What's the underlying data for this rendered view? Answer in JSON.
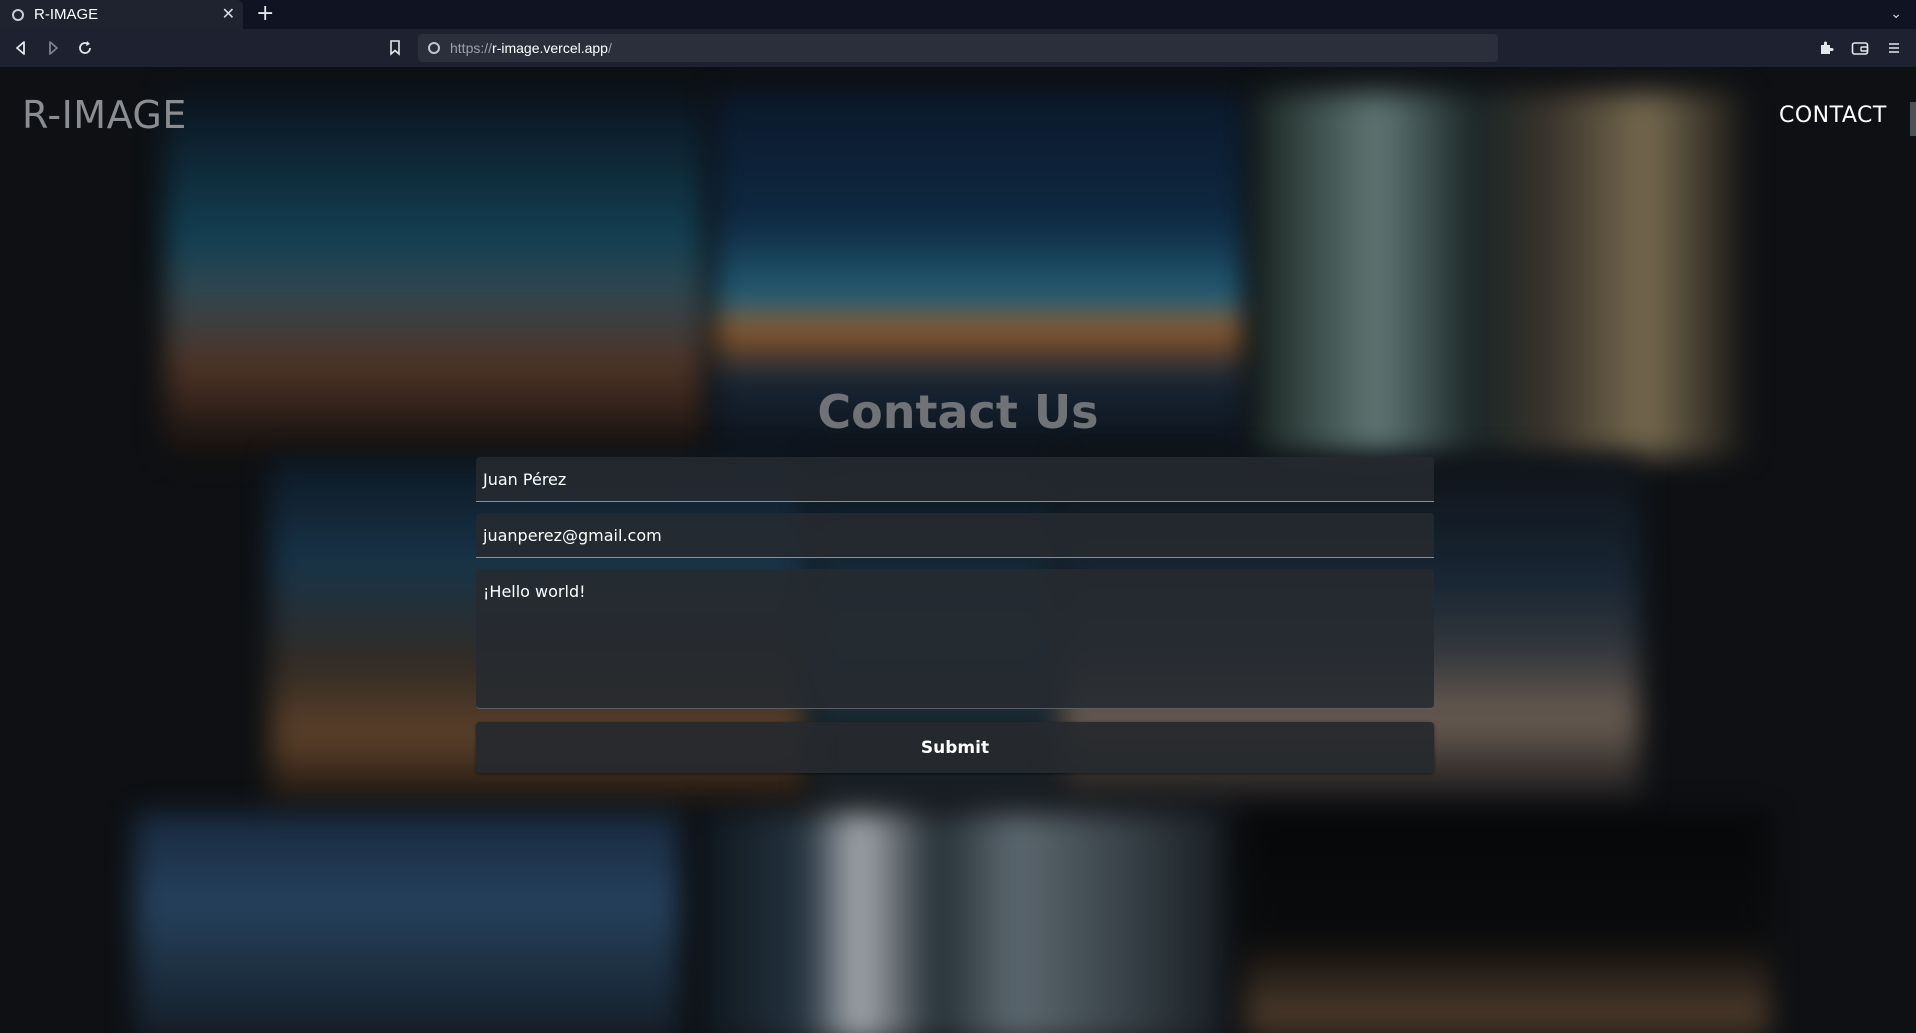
{
  "browser": {
    "tab_title": "R-IMAGE",
    "close_glyph": "✕",
    "new_tab_glyph": "+",
    "tab_list_glyph": "⌄",
    "url_scheme": "https://",
    "url_host": "r-image.vercel.app",
    "url_path": "/"
  },
  "header": {
    "brand": "R-IMAGE",
    "nav_contact": "CONTACT"
  },
  "contact": {
    "title": "Contact Us",
    "name_value": "Juan Pérez",
    "email_value": "juanperez@gmail.com",
    "message_value": "¡Hello world!",
    "submit_label": "Submit"
  },
  "colors": {
    "page_background": "#0e1013",
    "title_gray": "#6f7378",
    "field_background": "#262a30",
    "chrome_tabbar": "#0f1322",
    "chrome_toolbar": "#1e2230"
  }
}
